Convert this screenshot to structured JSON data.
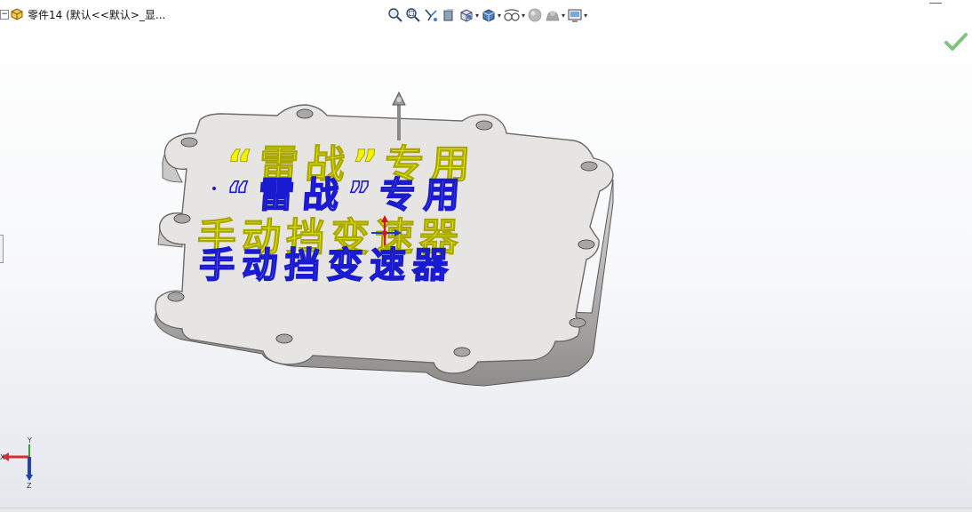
{
  "feature_tree": {
    "part_title": "零件14 (默认<<默认>_显..."
  },
  "hud_toolbar": {
    "icons": [
      "zoom-to-fit-icon",
      "zoom-area-icon",
      "previous-view-icon",
      "section-view-icon",
      "view-orientation-icon",
      "display-style-icon",
      "hide-show-items-icon",
      "edit-appearance-icon",
      "apply-scene-icon",
      "view-settings-icon"
    ]
  },
  "model": {
    "line1": "“雷战”专用",
    "line2": "手动挡变速器",
    "text_colors": {
      "face": "#f4f400",
      "outline": "#1a1ad0",
      "plate": "#e7e5e3",
      "edge": "#6d6b69"
    }
  },
  "triad": {
    "x_label": "X",
    "y_label": "Y",
    "z_label": "Z"
  },
  "colors": {
    "confirm_green": "#7ec57a",
    "triad_x": "#d32f2f",
    "triad_y": "#3c9a3c",
    "triad_z": "#2244aa"
  }
}
